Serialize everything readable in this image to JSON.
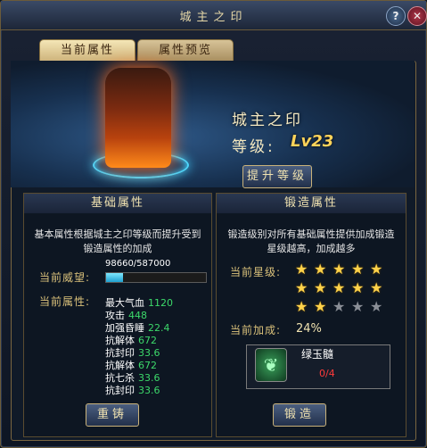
{
  "window": {
    "title": "城主之印"
  },
  "tabs": [
    {
      "label": "当前属性",
      "active": true
    },
    {
      "label": "属性预览",
      "active": false
    }
  ],
  "hero": {
    "seal_name": "城主之印",
    "level_label": "等级:",
    "level_value": "Lv23",
    "upgrade_button": "提升等级"
  },
  "basic": {
    "header": "基础属性",
    "desc": "基本属性根据城主之印等级而提升受到锻造属性的加成",
    "prestige_label": "当前威望:",
    "prestige_value": "98660/587000",
    "prestige_progress": 0.168,
    "attr_label": "当前属性:",
    "attributes": [
      {
        "name": "最大气血",
        "value": "1120"
      },
      {
        "name": "攻击",
        "value": "448"
      },
      {
        "name": "加强昏睡",
        "value": "22.4"
      },
      {
        "name": "抗解体",
        "value": "672"
      },
      {
        "name": "抗封印",
        "value": "33.6"
      },
      {
        "name": "抗解体",
        "value": "672"
      },
      {
        "name": "抗七杀",
        "value": "33.6"
      },
      {
        "name": "抗封印",
        "value": "33.6"
      }
    ],
    "recast_button": "重铸"
  },
  "forge": {
    "header": "锻造属性",
    "desc": "锻造级别对所有基础属性提供加成锻造星级越高，加成越多",
    "star_label": "当前星级:",
    "stars_total": 15,
    "stars_filled": 12,
    "bonus_label": "当前加成:",
    "bonus_value": "24%",
    "material_name": "绿玉髓",
    "material_count": "0/4",
    "forge_button": "锻造"
  },
  "colors": {
    "gold": "#d9c07a",
    "attr_value": "#3cd86a",
    "star": "#ffd24a",
    "warning": "#ff3a3a"
  }
}
